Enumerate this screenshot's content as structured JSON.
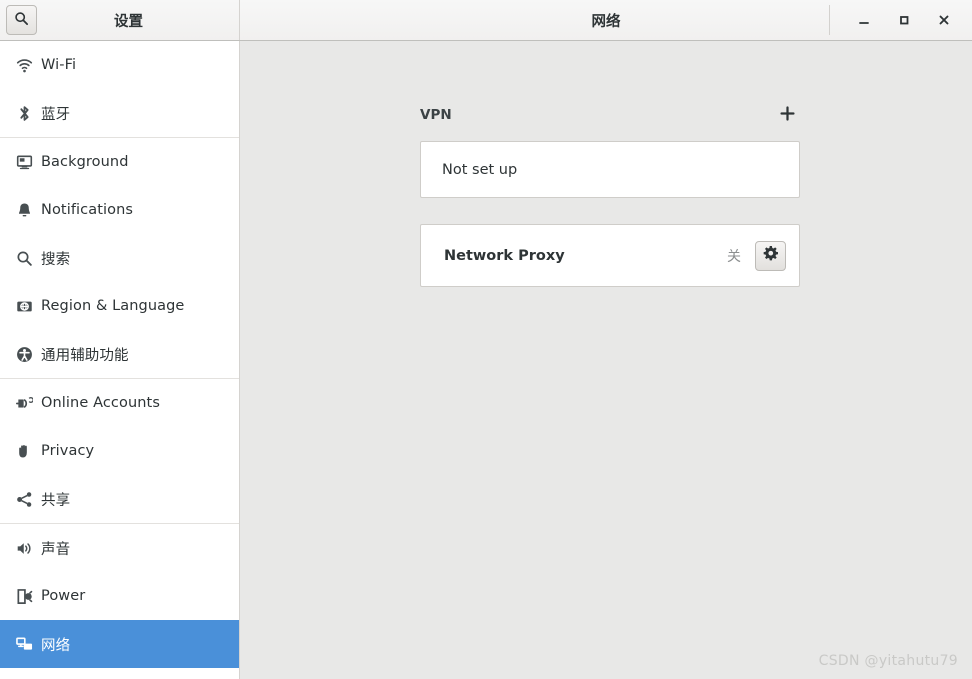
{
  "window": {
    "sidebar_title": "设置",
    "content_title": "网络",
    "search_icon": "search-icon",
    "controls": {
      "minimize_label": "—",
      "maximize_label": "□",
      "close_label": "✕"
    }
  },
  "sidebar": {
    "items": [
      {
        "label": "Wi-Fi",
        "icon": "wifi-icon",
        "name": "wifi",
        "selected": false,
        "separator_after": false
      },
      {
        "label": "蓝牙",
        "icon": "bluetooth-icon",
        "name": "bluetooth",
        "selected": false,
        "separator_after": true
      },
      {
        "label": "Background",
        "icon": "background-icon",
        "name": "background",
        "selected": false,
        "separator_after": false
      },
      {
        "label": "Notifications",
        "icon": "bell-icon",
        "name": "notifications",
        "selected": false,
        "separator_after": false
      },
      {
        "label": "搜索",
        "icon": "search-icon",
        "name": "search",
        "selected": false,
        "separator_after": false
      },
      {
        "label": "Region & Language",
        "icon": "region-icon",
        "name": "region-language",
        "selected": false,
        "separator_after": false
      },
      {
        "label": "通用辅助功能",
        "icon": "accessibility-icon",
        "name": "accessibility",
        "selected": false,
        "separator_after": true
      },
      {
        "label": "Online Accounts",
        "icon": "online-accounts-icon",
        "name": "online-accounts",
        "selected": false,
        "separator_after": false
      },
      {
        "label": "Privacy",
        "icon": "hand-icon",
        "name": "privacy",
        "selected": false,
        "separator_after": false
      },
      {
        "label": "共享",
        "icon": "share-icon",
        "name": "sharing",
        "selected": false,
        "separator_after": true
      },
      {
        "label": "声音",
        "icon": "speaker-icon",
        "name": "sound",
        "selected": false,
        "separator_after": false
      },
      {
        "label": "Power",
        "icon": "power-plug-icon",
        "name": "power",
        "selected": false,
        "separator_after": false
      },
      {
        "label": "网络",
        "icon": "network-icon",
        "name": "network",
        "selected": true,
        "separator_after": false
      }
    ]
  },
  "main": {
    "vpn": {
      "section_label": "VPN",
      "add_icon": "plus-icon",
      "status_text": "Not set up"
    },
    "proxy": {
      "name": "Network Proxy",
      "state": "关",
      "settings_icon": "gear-icon"
    }
  },
  "watermark": {
    "text": "CSDN @yitahutu79"
  },
  "colors": {
    "selection": "#4a90d9",
    "content_bg": "#e8e8e7",
    "card_bg": "#ffffff",
    "text": "#2e3436"
  }
}
